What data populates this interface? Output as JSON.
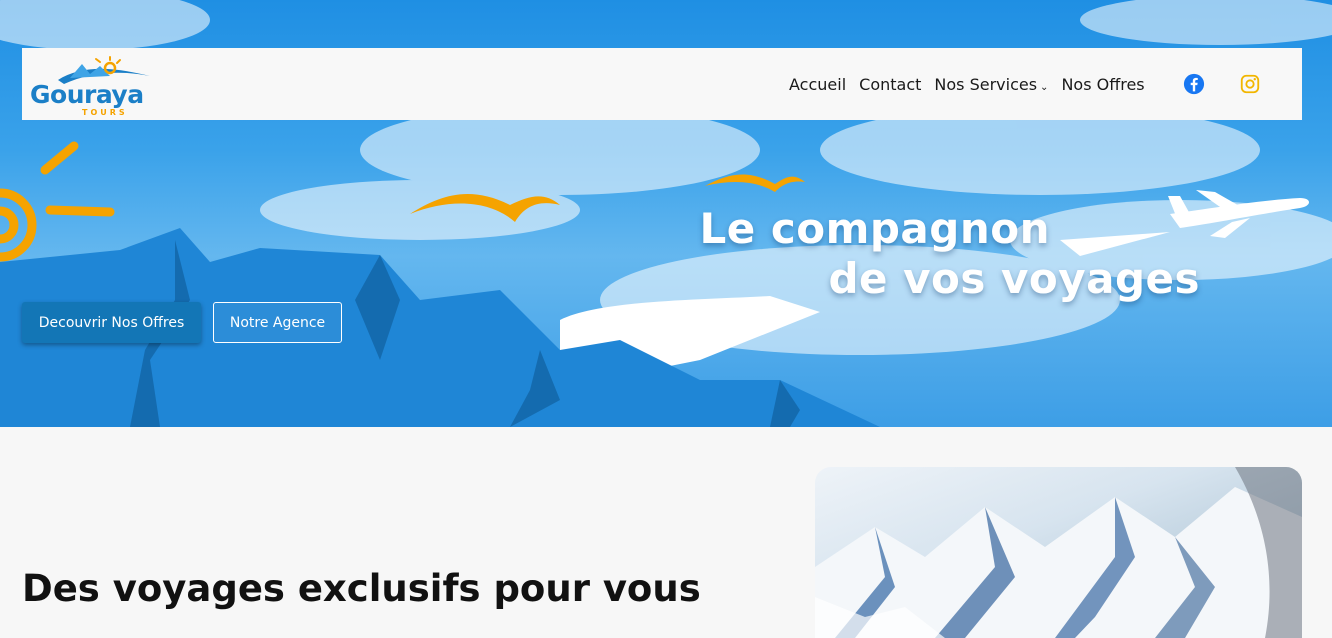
{
  "brand": {
    "name": "Gouraya",
    "tagline": "TOURS"
  },
  "nav": {
    "items": [
      {
        "label": "Accueil"
      },
      {
        "label": "Contact"
      },
      {
        "label": "Nos Services",
        "has_dropdown": true
      },
      {
        "label": "Nos Offres"
      }
    ],
    "social": [
      "facebook-icon",
      "instagram-icon"
    ]
  },
  "hero": {
    "line1": "Le compagnon",
    "line2": "de vos voyages",
    "primary_button": "Decouvrir Nos Offres",
    "secondary_button": "Notre Agence"
  },
  "section": {
    "title": "Des voyages exclusifs pour vous"
  },
  "colors": {
    "brand_blue": "#1b7fc7",
    "brand_orange": "#f5a300",
    "button_blue": "#1376b6",
    "facebook": "#1877f2",
    "instagram": "#f2b600"
  }
}
